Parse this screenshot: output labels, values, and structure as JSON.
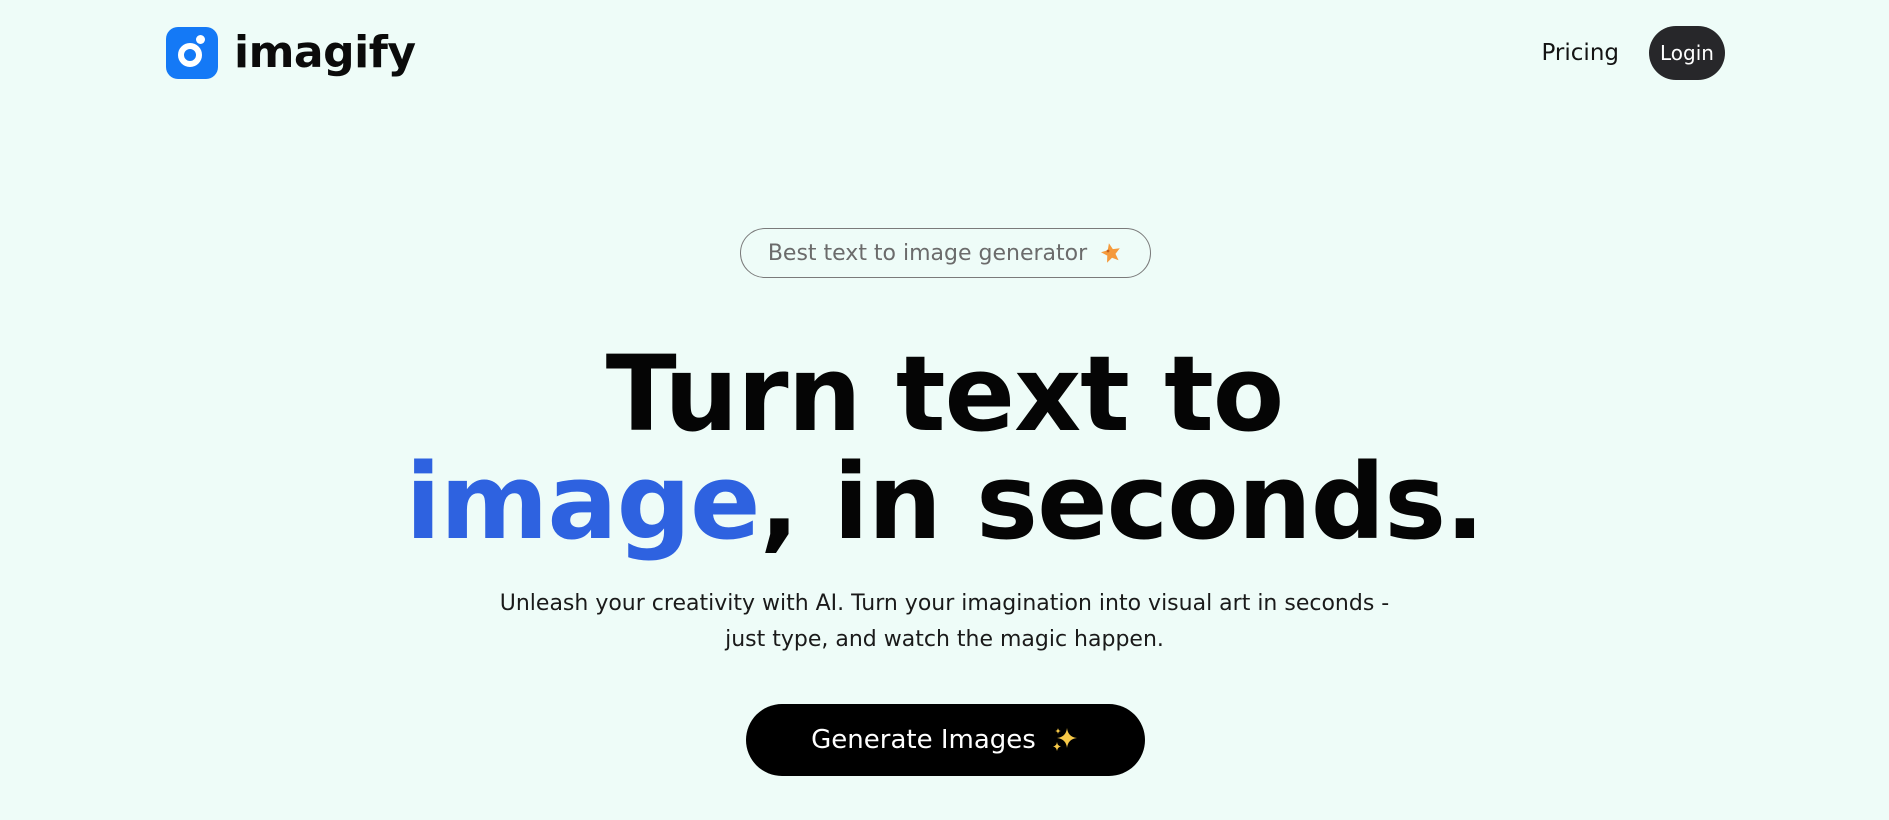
{
  "header": {
    "brand_name": "imagify",
    "logo_icon": "camera-lens-icon",
    "nav": {
      "pricing_label": "Pricing",
      "login_label": "Login"
    }
  },
  "hero": {
    "badge": {
      "label": "Best text to image generator",
      "icon": "star-icon",
      "icon_color": "#f59a3c"
    },
    "headline": {
      "line1": "Turn text to",
      "highlight": "image",
      "line2_rest": ", in seconds."
    },
    "subtext": "Unleash your creativity with AI. Turn your imagination into visual art in seconds - just type, and watch the magic happen.",
    "cta": {
      "label": "Generate Images",
      "icon": "sparkles-icon"
    }
  },
  "colors": {
    "background": "#eefcf8",
    "brand_blue": "#1479f6",
    "headline_accent": "#2e62e0",
    "login_bg": "#27272a",
    "cta_bg": "#000000"
  }
}
